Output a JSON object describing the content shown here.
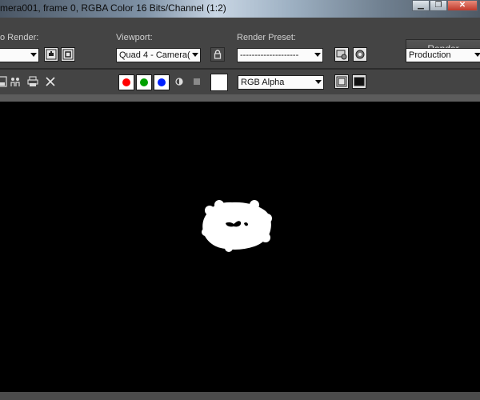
{
  "window": {
    "title": "mera001, frame 0, RGBA Color 16 Bits/Channel (1:2)",
    "minimize_glyph": "▁",
    "restore_glyph": "❐",
    "close_glyph": "✕"
  },
  "controls": {
    "area_to_render": {
      "label": "o Render:",
      "value": ""
    },
    "viewport": {
      "label": "Viewport:",
      "value": "Quad 4 - Camera("
    },
    "render_preset": {
      "label": "Render Preset:",
      "value": "--------------------"
    },
    "render_button": "Render",
    "production": {
      "value": "Production"
    }
  },
  "toolbar": {
    "channel_display": {
      "value": "RGB Alpha"
    },
    "colors": {
      "red": "#ff0000",
      "green": "#00a000",
      "blue": "#0020ff"
    }
  }
}
